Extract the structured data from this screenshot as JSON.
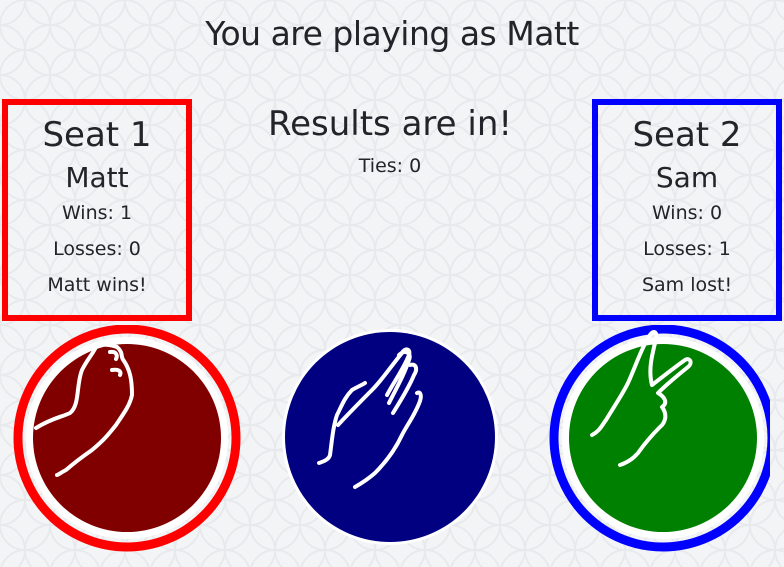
{
  "header": {
    "title": "You are playing as Matt"
  },
  "seat1": {
    "title": "Seat 1",
    "name": "Matt",
    "wins": "Wins: 1",
    "losses": "Losses: 0",
    "result": "Matt wins!",
    "color": "#ff0000",
    "choice": "rock",
    "choice_color": "#800000"
  },
  "seat2": {
    "title": "Seat 2",
    "name": "Sam",
    "wins": "Wins: 0",
    "losses": "Losses: 1",
    "result": "Sam lost!",
    "color": "#0000ff",
    "choice": "scissors",
    "choice_color": "#008000"
  },
  "center": {
    "title": "Results are in!",
    "ties": "Ties: 0",
    "choice": "paper",
    "choice_color": "#000080"
  }
}
